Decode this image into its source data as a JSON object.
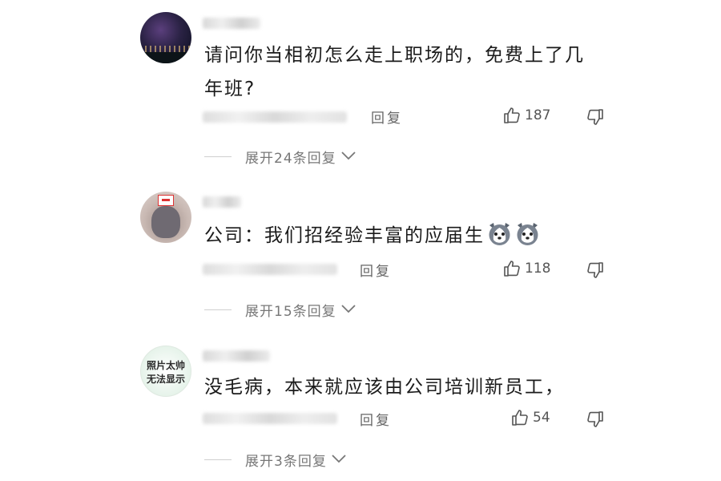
{
  "comments": [
    {
      "text": "请问你当相初怎么走上职场的，免费上了几年班?",
      "reply_label": "回复",
      "likes": "187",
      "expand_label": "展开24条回复"
    },
    {
      "text": "公司：我们招经验丰富的应届生",
      "emojis": [
        "husky-emoji",
        "husky-emoji"
      ],
      "reply_label": "回复",
      "likes": "118",
      "expand_label": "展开15条回复"
    },
    {
      "avatar_text": [
        "照片太帅",
        "无法显示"
      ],
      "text": "没毛病，本来就应该由公司培训新员工，",
      "reply_label": "回复",
      "likes": "54",
      "expand_label": "展开3条回复"
    }
  ],
  "icons": {
    "like": "thumb-up-icon",
    "dislike": "thumb-down-icon",
    "expand": "chevron-down-icon"
  },
  "colors": {
    "text": "#1b1b1b",
    "meta": "#666666",
    "expand": "#777777"
  }
}
